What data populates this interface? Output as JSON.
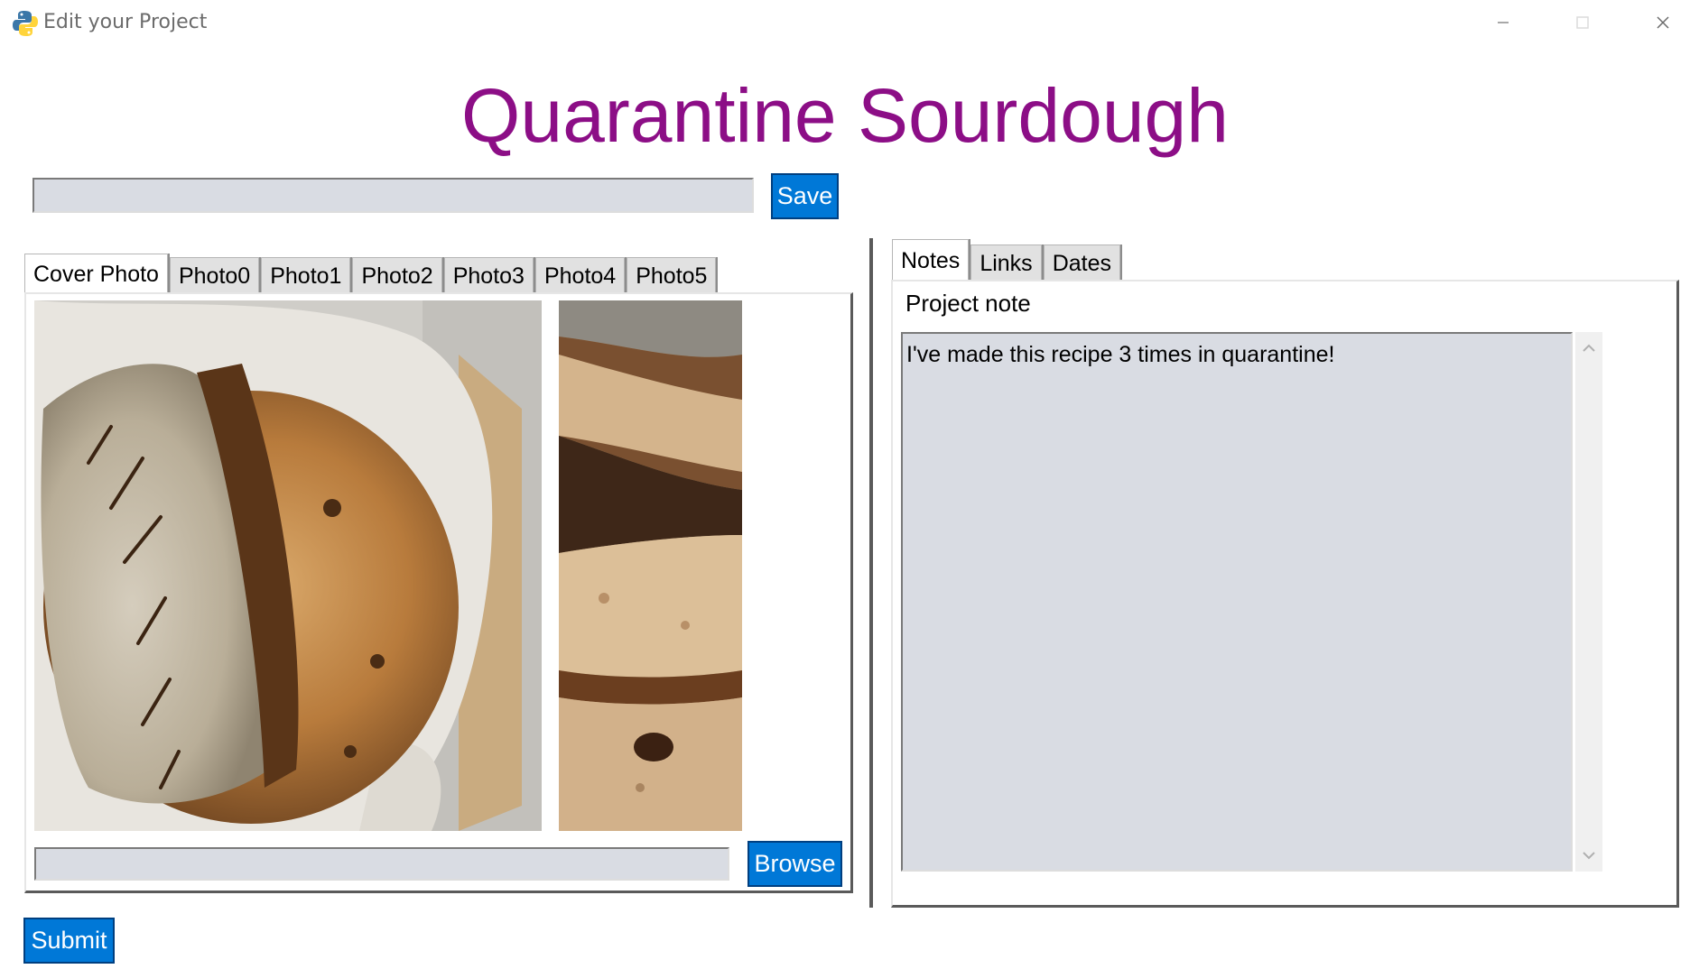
{
  "window": {
    "title": "Edit your Project",
    "icons": {
      "app": "python-icon",
      "minimize": "minimize-icon",
      "maximize": "maximize-icon",
      "close": "close-icon"
    }
  },
  "heading": "Quarantine Sourdough",
  "colors": {
    "heading": "#8c0e86",
    "button": "#0078d7",
    "entry": "#d9dce3"
  },
  "title_entry": {
    "value": ""
  },
  "buttons": {
    "save": "Save",
    "browse": "Browse",
    "submit": "Submit"
  },
  "photo_tabs": [
    "Cover Photo",
    "Photo0",
    "Photo1",
    "Photo2",
    "Photo3",
    "Photo4",
    "Photo5"
  ],
  "photo_tabs_active": "Cover Photo",
  "photo_path": {
    "value": ""
  },
  "info_tabs": [
    "Notes",
    "Links",
    "Dates"
  ],
  "info_tabs_active": "Notes",
  "notes": {
    "label": "Project note",
    "text": "I've made this recipe 3 times in quarantine!"
  }
}
